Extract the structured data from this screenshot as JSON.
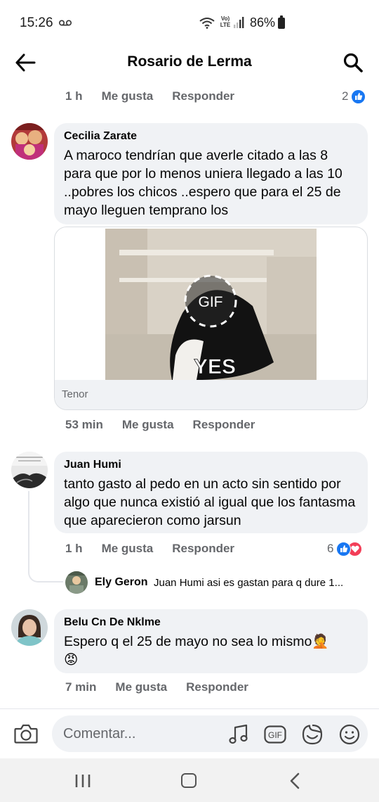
{
  "status_bar": {
    "time": "15:26",
    "battery": "86%",
    "volte": "Vo)) LTE"
  },
  "header": {
    "title": "Rosario de Lerma"
  },
  "prev_comment_actions": {
    "time": "1 h",
    "like": "Me gusta",
    "reply": "Responder",
    "reaction_count": "2"
  },
  "comments": [
    {
      "author": "Cecilia Zarate",
      "text": "A maroco tendrían que averle citado a las 8 para que por lo menos uniera  llegado a las 10 ..pobres los chicos ..espero que para el 25 de mayo lleguen temprano los",
      "gif": {
        "badge": "GIF",
        "caption": "YES",
        "source": "Tenor"
      },
      "time": "53 min",
      "like": "Me gusta",
      "reply": "Responder"
    },
    {
      "author": "Juan Humi",
      "text": "tanto gasto al pedo en un acto sin sentido por algo que nunca existió al igual que los fantasma que aparecieron como jarsun",
      "time": "1 h",
      "like": "Me gusta",
      "reply": "Responder",
      "reaction_count": "6",
      "reply_preview": {
        "author": "Ely Geron",
        "text": "Juan Humi asi es gastan para q dure 1..."
      }
    },
    {
      "author": "Belu Cn De Nklme",
      "text": "Espero q el 25 de mayo no sea lo mismo🤦",
      "emoji_line": "😡",
      "time": "7 min",
      "like": "Me gusta",
      "reply": "Responder"
    }
  ],
  "composer": {
    "placeholder": "Comentar...",
    "gif_label": "GIF"
  },
  "colors": {
    "like_blue": "#1877f2",
    "love_red": "#f33e58",
    "bubble_bg": "#f0f2f5",
    "meta_gray": "#65676b"
  }
}
